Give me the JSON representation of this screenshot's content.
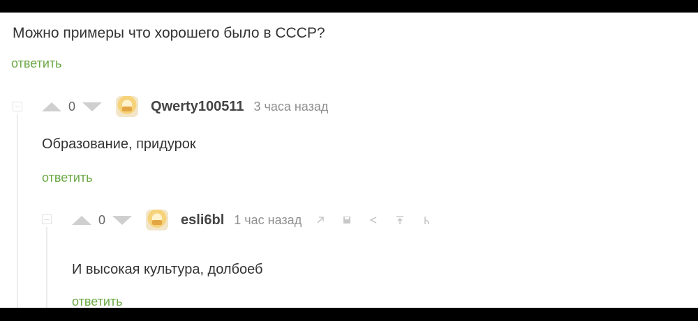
{
  "post": {
    "question": "Можно примеры что хорошего было в СССР?",
    "reply_label": "ответить"
  },
  "comments": [
    {
      "score": "0",
      "username": "Qwerty100511",
      "time": "3 часа назад",
      "text": "Образование, придурок",
      "reply_label": "ответить"
    },
    {
      "score": "0",
      "username": "esli6bl",
      "time": "1 час назад",
      "text": "И высокая культура, долбоеб",
      "reply_label": "ответить",
      "controls": [
        "link-icon",
        "save-icon",
        "share-icon",
        "pin-icon",
        "branch-icon"
      ]
    }
  ],
  "colors": {
    "reply": "#6aa844",
    "vote": "#cfcfcf",
    "meta": "#8f8f8f"
  }
}
